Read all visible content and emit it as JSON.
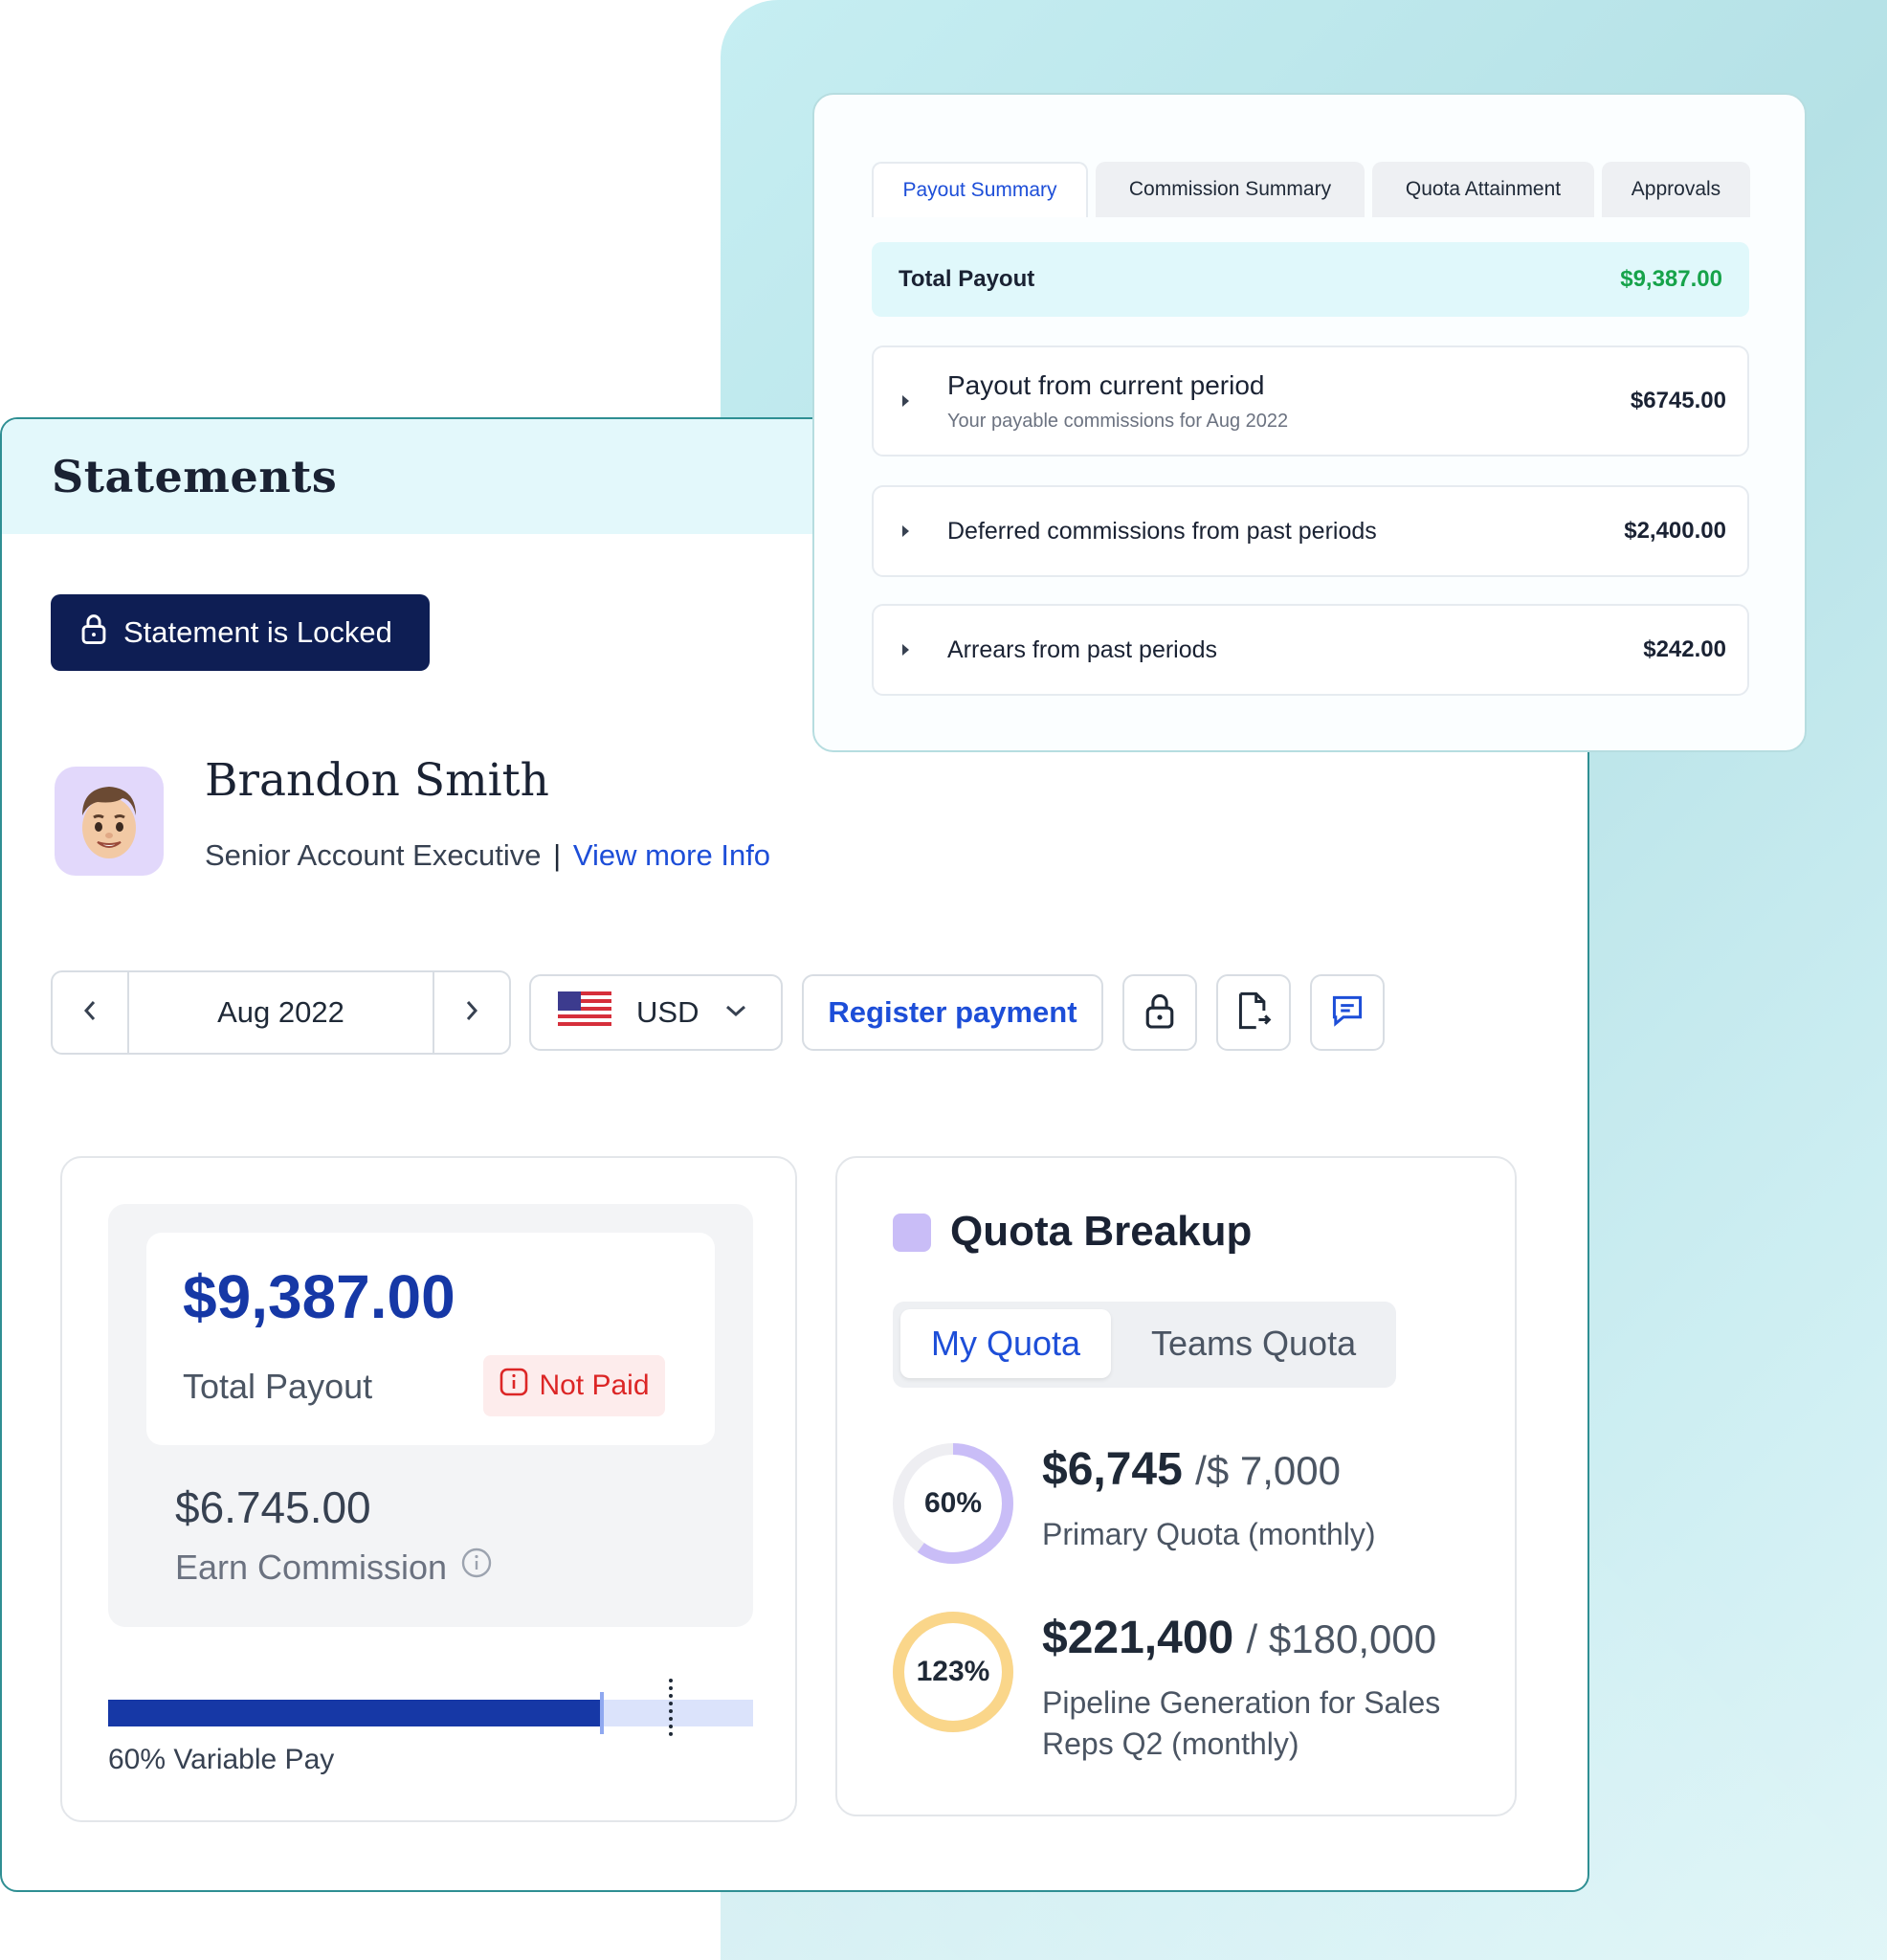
{
  "statements": {
    "title": "Statements",
    "locked_badge": "Statement is Locked",
    "user": {
      "name": "Brandon Smith",
      "role": "Senior Account Executive",
      "separator": "|",
      "more_info_link": "View more Info"
    },
    "toolbar": {
      "period": "Aug 2022",
      "currency": "USD",
      "register_payment": "Register payment"
    },
    "payout": {
      "amount": "$9,387.00",
      "label": "Total Payout",
      "status": "Not Paid",
      "earn_amount": "$6.745.00",
      "earn_label": "Earn Commission",
      "variable_pay_label": "60% Variable Pay",
      "variable_pay_fill": 0.765,
      "variable_pay_target": 0.87
    },
    "quota": {
      "title": "Quota Breakup",
      "tabs": [
        "My Quota",
        "Teams Quota"
      ],
      "active_tab": "My Quota",
      "items": [
        {
          "percent_label": "60%",
          "percent": 60,
          "amount": "$6,745",
          "target": "/$ 7,000",
          "description": "Primary Quota (monthly)",
          "color": "#c9bdf7"
        },
        {
          "percent_label": "123%",
          "percent": 123,
          "amount": "$221,400",
          "target": "/ $180,000",
          "description": "Pipeline Generation for Sales Reps Q2 (monthly)",
          "color": "#fad68a"
        }
      ]
    }
  },
  "summary": {
    "tabs": [
      "Payout Summary",
      "Commission Summary",
      "Quota Attainment",
      "Approvals"
    ],
    "active_tab": "Payout Summary",
    "total_label": "Total Payout",
    "total_value": "$9,387.00",
    "rows": [
      {
        "title": "Payout from current period",
        "subtitle": "Your payable commissions for Aug 2022",
        "value": "$6745.00"
      },
      {
        "title": "Deferred commissions from past periods",
        "value": "$2,400.00"
      },
      {
        "title": "Arrears from past periods",
        "value": "$242.00"
      }
    ]
  },
  "colors": {
    "brand_navy": "#0e1e54",
    "accent_blue": "#1d4ed8",
    "payout_blue": "#1638a6",
    "success_green": "#16a34a",
    "danger_red": "#dc2626",
    "teal_header": "#e3f8fb"
  },
  "icons": [
    "lock-icon",
    "chevron-left-icon",
    "chevron-right-icon",
    "us-flag-icon",
    "chevron-down-icon",
    "file-export-icon",
    "comment-icon",
    "info-icon",
    "caret-right-icon"
  ]
}
